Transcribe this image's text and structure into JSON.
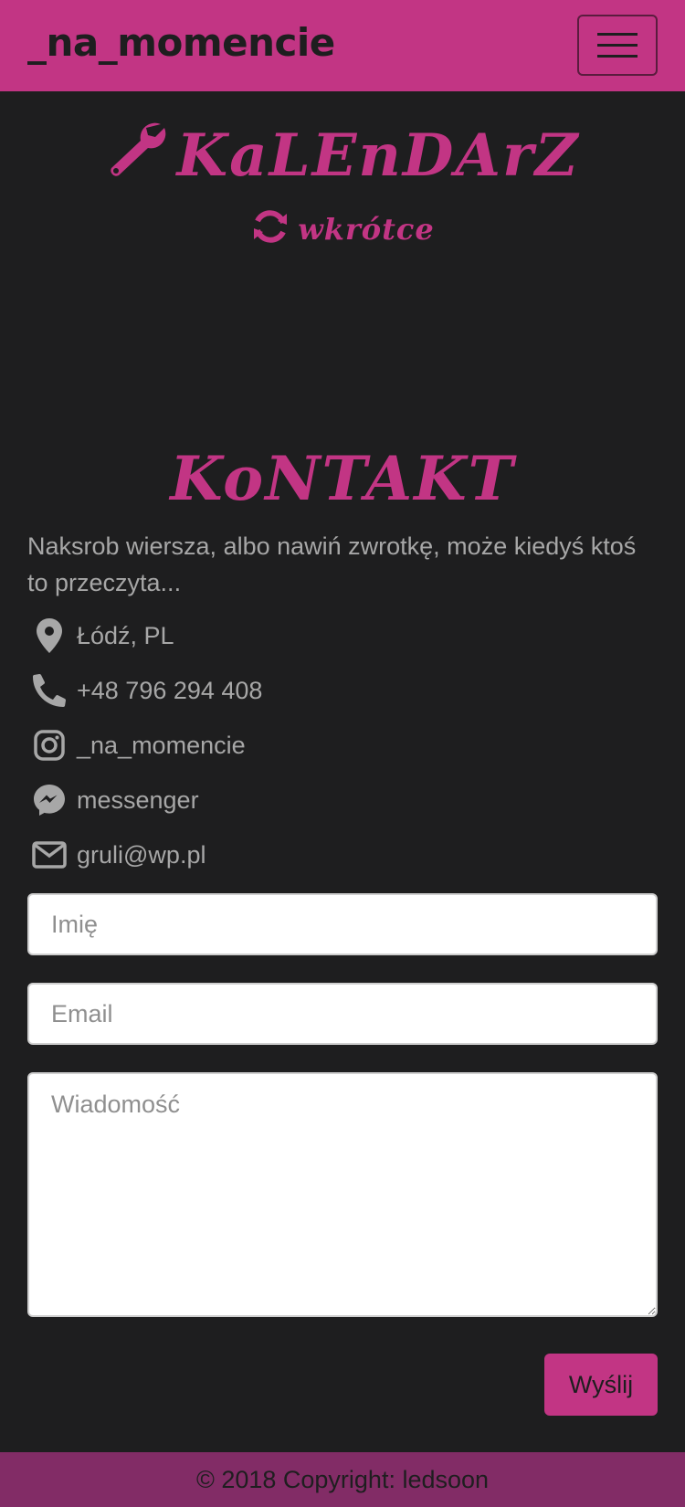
{
  "navbar": {
    "brand": "_na_momencie",
    "toggle_icon": "hamburger-icon"
  },
  "calendar": {
    "title": "KaLEnDArZ",
    "subtitle": "wkrótce",
    "title_icon": "wrench-icon",
    "subtitle_icon": "sync-icon"
  },
  "contact": {
    "title": "KoNTAKT",
    "intro": "Naksrob wiersza, albo nawiń zwrotkę, może kiedyś ktoś to przeczyta...",
    "items": [
      {
        "icon": "map-marker-icon",
        "text": "Łódź, PL"
      },
      {
        "icon": "phone-icon",
        "text": "+48 796 294 408"
      },
      {
        "icon": "instagram-icon",
        "text": "_na_momencie"
      },
      {
        "icon": "messenger-icon",
        "text": "messenger"
      },
      {
        "icon": "envelope-icon",
        "text": "gruli@wp.pl"
      }
    ]
  },
  "form": {
    "name_placeholder": "Imię",
    "email_placeholder": "Email",
    "message_placeholder": "Wiadomość",
    "submit_label": "Wyślij"
  },
  "footer": {
    "text": "© 2018 Copyright: ledsoon"
  },
  "colors": {
    "accent": "#c23584",
    "background": "#1e1e1f",
    "footer": "#822c66",
    "text": "#a7a7a7"
  }
}
